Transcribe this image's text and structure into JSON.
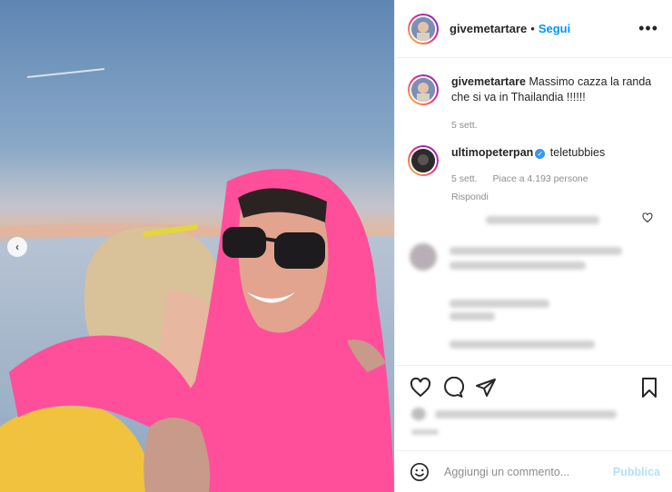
{
  "post": {
    "author": "givemetartare",
    "follow_label": "Segui",
    "separator": "•",
    "more_label": "•••"
  },
  "caption": {
    "username": "givemetartare",
    "text": "Massimo cazza la randa che si va in Thailandia !!!!!!",
    "time": "5 sett."
  },
  "comment1": {
    "username": "ultimopeterpan",
    "verified_mark": "✓",
    "text": "teletubbies",
    "time": "5 sett.",
    "likes": "Piace a 4.193 persone",
    "reply_label": "Rispondi"
  },
  "nav": {
    "prev_label": "‹"
  },
  "add_comment": {
    "placeholder": "Aggiungi un commento...",
    "publish_label": "Pubblica"
  },
  "colors": {
    "link": "#0095f6",
    "verified": "#3897f0",
    "publish_disabled": "#b2dffc"
  }
}
